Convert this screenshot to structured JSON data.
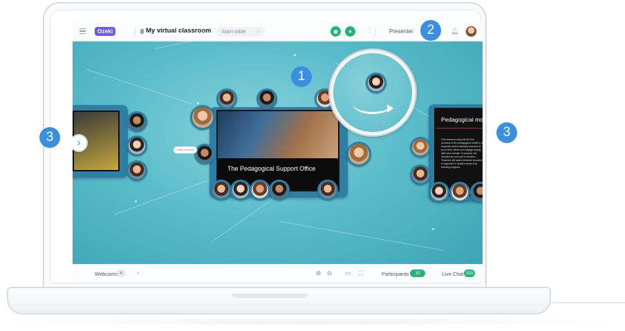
{
  "topbar": {
    "logo_text": "Ozeki",
    "room_title": "My virtual classroom",
    "table_select_value": "Main table",
    "presenter_label": "Presenter",
    "icons": [
      "menu-icon",
      "lock-icon",
      "edit-icon",
      "chevron-down-icon",
      "location-icon",
      "mic-icon",
      "more-icon",
      "bell-icon",
      "avatar"
    ]
  },
  "canvas": {
    "center_video_caption": "The Pedagogical Support Office",
    "right_slide_title": "Pedagogical mode",
    "right_slide_text": "This resource supports the five domains of the pedagogical model in a separate section allowing teachers to focus their efforts and engage deeply with each domain. In practice, the domains do not exist in isolation. Teachers will switch between domains in response to student needs and learning progress.",
    "tooltip_text": "Check members",
    "accent_color": "#2d7fa3"
  },
  "bottombar": {
    "webcams_label": "Webcams",
    "webcams_count": "4",
    "participants_label": "Participants",
    "participants_count": "10",
    "livechat_label": "Live Chat",
    "livechat_count": "150"
  },
  "callouts": [
    "1",
    "2",
    "3",
    "3"
  ]
}
